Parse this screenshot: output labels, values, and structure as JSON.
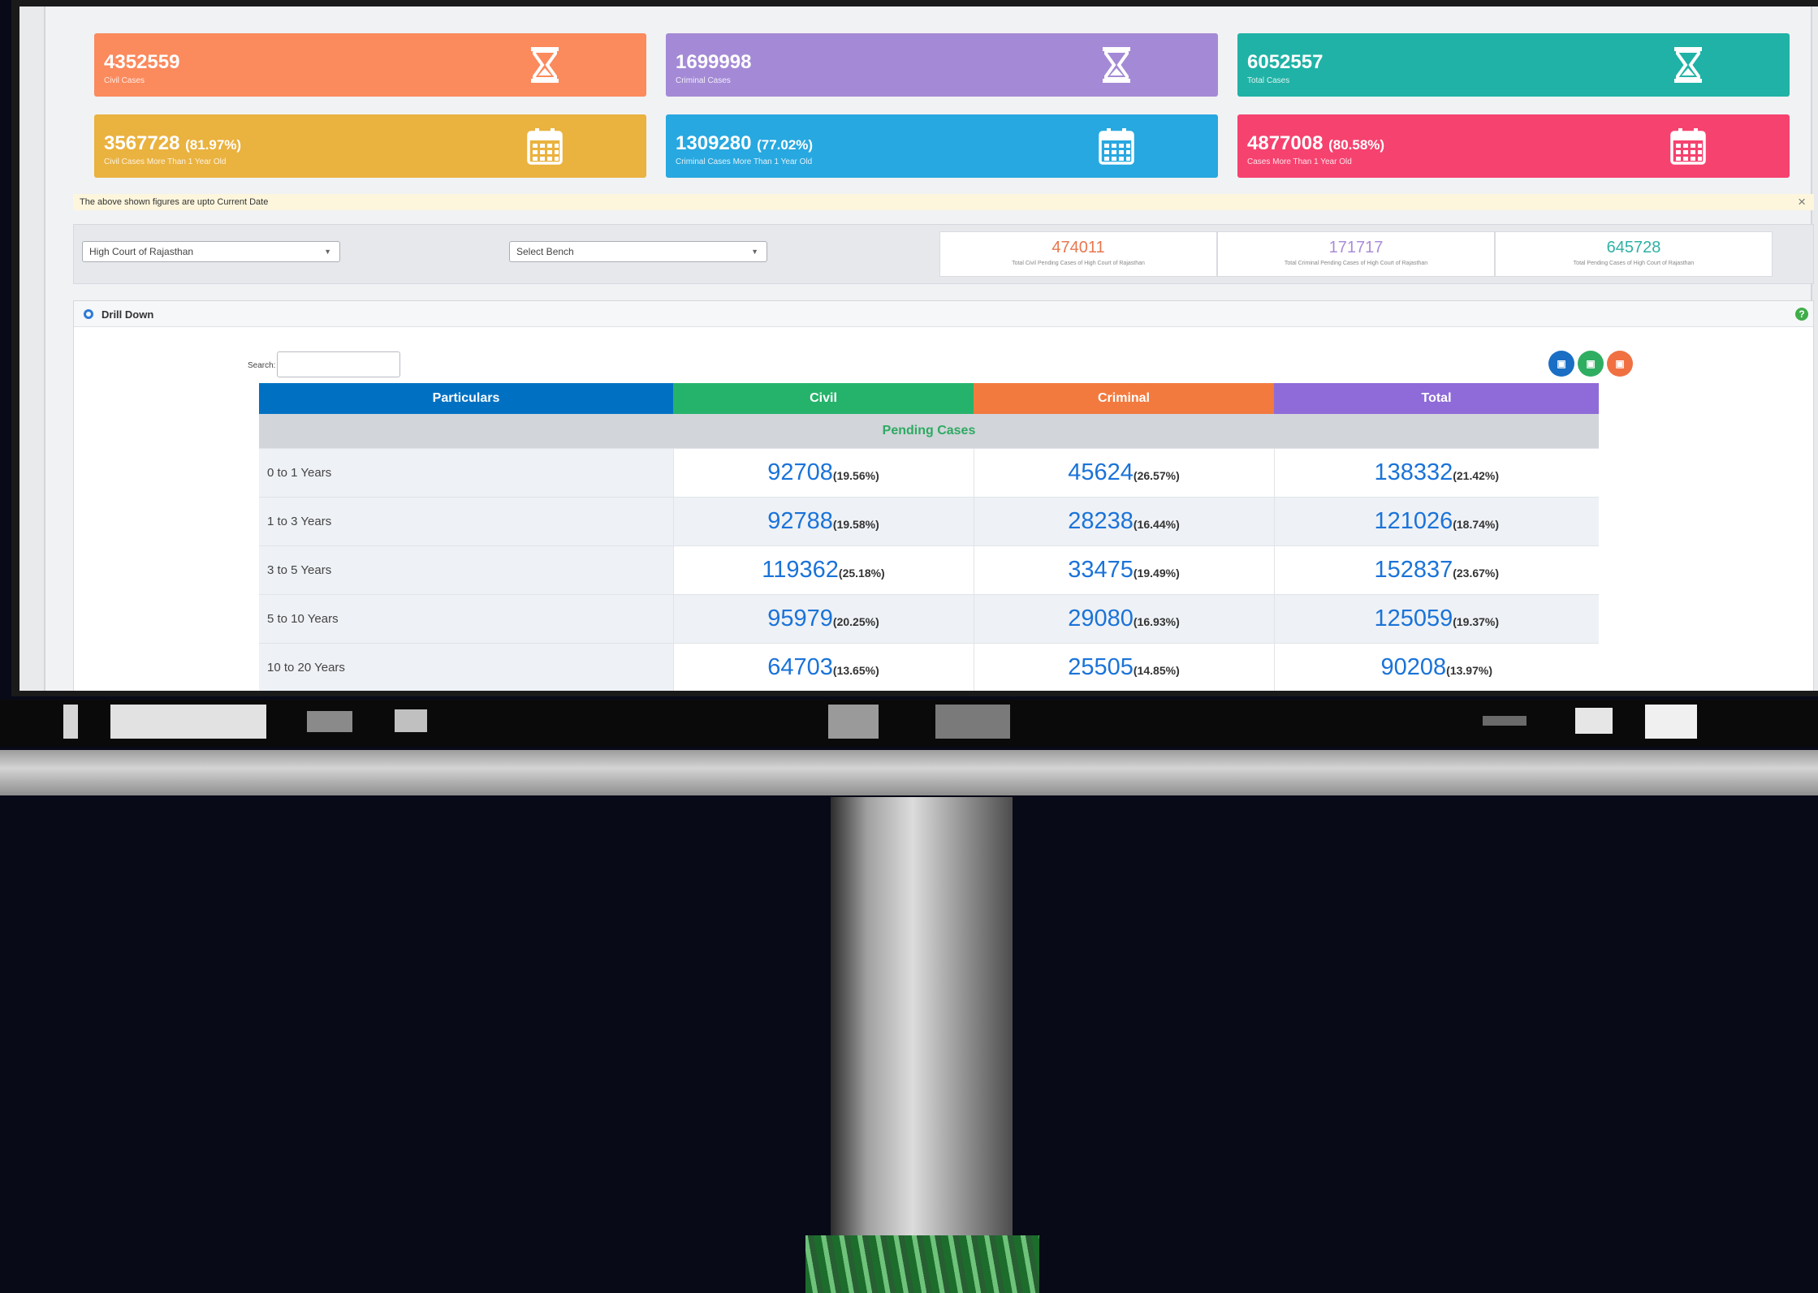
{
  "cards": [
    {
      "value": "4352559",
      "pct": "",
      "label": "Civil Cases",
      "icon": "hourglass-icon",
      "color": "#fb8a5d"
    },
    {
      "value": "1699998",
      "pct": "",
      "label": "Criminal Cases",
      "icon": "hourglass-icon",
      "color": "#a48ad6"
    },
    {
      "value": "6052557",
      "pct": "",
      "label": "Total Cases",
      "icon": "hourglass-icon",
      "color": "#20b2a6"
    },
    {
      "value": "3567728",
      "pct": "(81.97%)",
      "label": "Civil Cases More Than 1 Year Old",
      "icon": "calendar-icon",
      "color": "#eab23f"
    },
    {
      "value": "1309280",
      "pct": "(77.02%)",
      "label": "Criminal Cases More Than 1 Year Old",
      "icon": "calendar-icon",
      "color": "#28a8e0"
    },
    {
      "value": "4877008",
      "pct": "(80.58%)",
      "label": "Cases More Than 1 Year Old",
      "icon": "calendar-icon",
      "color": "#f6426f"
    }
  ],
  "notice": {
    "text": "The above shown figures are upto Current Date",
    "close": "×"
  },
  "filters": {
    "court": "High Court of Rajasthan",
    "bench": "Select Bench"
  },
  "stats": [
    {
      "value": "474011",
      "label": "Total Civil Pending Cases of High Court of Rajasthan",
      "color": "#e8774f"
    },
    {
      "value": "171717",
      "label": "Total Criminal Pending Cases of High Court of Rajasthan",
      "color": "#a98cd8"
    },
    {
      "value": "645728",
      "label": "Total Pending Cases of High Court of Rajasthan",
      "color": "#2fb1a5"
    }
  ],
  "panel": {
    "title": "Drill Down",
    "help": "?"
  },
  "search": {
    "label": "Search:",
    "value": ""
  },
  "exports": [
    {
      "icon": "pdf-export-icon",
      "color": "#1a6fc4",
      "glyph": "▣"
    },
    {
      "icon": "excel-export-icon",
      "color": "#2fae62",
      "glyph": "▣"
    },
    {
      "icon": "csv-export-icon",
      "color": "#f07042",
      "glyph": "▣"
    }
  ],
  "table": {
    "headers": [
      {
        "label": "Particulars",
        "color": "#0071c2"
      },
      {
        "label": "Civil",
        "color": "#25b36b"
      },
      {
        "label": "Criminal",
        "color": "#f27a3e"
      },
      {
        "label": "Total",
        "color": "#8e6bd8"
      }
    ],
    "group": "Pending Cases",
    "rows": [
      {
        "label": "0 to 1 Years",
        "civil": "92708",
        "civil_pct": "(19.56%)",
        "criminal": "45624",
        "criminal_pct": "(26.57%)",
        "total": "138332",
        "total_pct": "(21.42%)"
      },
      {
        "label": "1 to 3 Years",
        "civil": "92788",
        "civil_pct": "(19.58%)",
        "criminal": "28238",
        "criminal_pct": "(16.44%)",
        "total": "121026",
        "total_pct": "(18.74%)"
      },
      {
        "label": "3 to 5 Years",
        "civil": "119362",
        "civil_pct": "(25.18%)",
        "criminal": "33475",
        "criminal_pct": "(19.49%)",
        "total": "152837",
        "total_pct": "(23.67%)"
      },
      {
        "label": "5 to 10 Years",
        "civil": "95979",
        "civil_pct": "(20.25%)",
        "criminal": "29080",
        "criminal_pct": "(16.93%)",
        "total": "125059",
        "total_pct": "(19.37%)"
      },
      {
        "label": "10 to 20 Years",
        "civil": "64703",
        "civil_pct": "(13.65%)",
        "criminal": "25505",
        "criminal_pct": "(14.85%)",
        "total": "90208",
        "total_pct": "(13.97%)"
      }
    ]
  }
}
